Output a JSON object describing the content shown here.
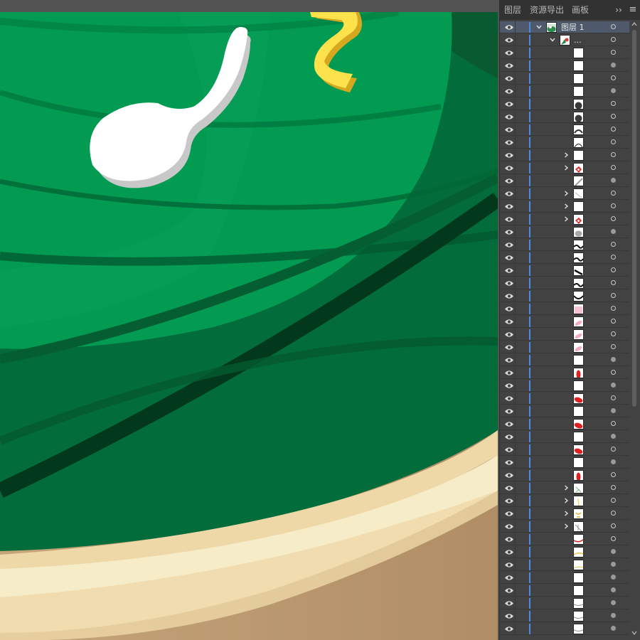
{
  "tabs": [
    {
      "label": "图层",
      "active": true
    },
    {
      "label": "资源导出",
      "active": false
    },
    {
      "label": "画板",
      "active": false
    }
  ],
  "panel_buttons": {
    "collapse": "››",
    "menu": "≡"
  },
  "layer_top": {
    "name": "图层 1",
    "thumbnail": "layer-thumb-icon"
  },
  "group_row": {
    "name": "...",
    "thumbnail": "group-thumb-icon"
  },
  "sublayers": [
    {
      "thumb": "blank",
      "expandable": false,
      "target": "ring"
    },
    {
      "thumb": "blank",
      "expandable": false,
      "target": "fill"
    },
    {
      "thumb": "blank",
      "expandable": false,
      "target": "ring"
    },
    {
      "thumb": "blank",
      "expandable": false,
      "target": "fill"
    },
    {
      "thumb": "dark-circle",
      "expandable": false,
      "target": "ring"
    },
    {
      "thumb": "dark-circle",
      "expandable": false,
      "target": "ring"
    },
    {
      "thumb": "arc",
      "expandable": false,
      "target": "ring"
    },
    {
      "thumb": "arc-open",
      "expandable": false,
      "target": "ring"
    },
    {
      "thumb": "blank",
      "expandable": true,
      "target": "ring"
    },
    {
      "thumb": "red-shape",
      "expandable": true,
      "target": "ring"
    },
    {
      "thumb": "stroke-gray",
      "expandable": false,
      "target": "fill"
    },
    {
      "thumb": "stroke-light",
      "expandable": true,
      "target": "ring"
    },
    {
      "thumb": "blank",
      "expandable": true,
      "target": "ring"
    },
    {
      "thumb": "red-shape",
      "expandable": true,
      "target": "ring"
    },
    {
      "thumb": "gray-blob",
      "expandable": false,
      "target": "fill"
    },
    {
      "thumb": "black-wave",
      "expandable": false,
      "target": "ring"
    },
    {
      "thumb": "black-wave",
      "expandable": false,
      "target": "ring"
    },
    {
      "thumb": "black-diag",
      "expandable": false,
      "target": "ring"
    },
    {
      "thumb": "black-wave",
      "expandable": false,
      "target": "ring"
    },
    {
      "thumb": "black-curve",
      "expandable": false,
      "target": "ring"
    },
    {
      "thumb": "pink-fill",
      "expandable": false,
      "target": "ring"
    },
    {
      "thumb": "pink-oval",
      "expandable": false,
      "target": "ring"
    },
    {
      "thumb": "pink-oval",
      "expandable": false,
      "target": "ring"
    },
    {
      "thumb": "pink-oval",
      "expandable": false,
      "target": "ring"
    },
    {
      "thumb": "blank",
      "expandable": false,
      "target": "fill"
    },
    {
      "thumb": "red-oval-v",
      "expandable": false,
      "target": "ring"
    },
    {
      "thumb": "blank",
      "expandable": false,
      "target": "fill"
    },
    {
      "thumb": "red-oval",
      "expandable": false,
      "target": "ring"
    },
    {
      "thumb": "blank",
      "expandable": false,
      "target": "fill"
    },
    {
      "thumb": "red-oval",
      "expandable": false,
      "target": "ring"
    },
    {
      "thumb": "blank",
      "expandable": false,
      "target": "fill"
    },
    {
      "thumb": "red-oval",
      "expandable": false,
      "target": "ring"
    },
    {
      "thumb": "blank",
      "expandable": false,
      "target": "fill"
    },
    {
      "thumb": "red-oval-v",
      "expandable": false,
      "target": "ring"
    },
    {
      "thumb": "sketch-green",
      "expandable": true,
      "target": "ring"
    },
    {
      "thumb": "sketch-yellow",
      "expandable": true,
      "target": "ring"
    },
    {
      "thumb": "sketch-gold",
      "expandable": true,
      "target": "ring"
    },
    {
      "thumb": "sketch-gray",
      "expandable": true,
      "target": "ring"
    },
    {
      "thumb": "red-line",
      "expandable": false,
      "target": "ring"
    },
    {
      "thumb": "yellow-line",
      "expandable": false,
      "target": "fill"
    },
    {
      "thumb": "yellow-line2",
      "expandable": false,
      "target": "fill"
    },
    {
      "thumb": "blank",
      "expandable": false,
      "target": "fill"
    },
    {
      "thumb": "blank",
      "expandable": false,
      "target": "fill"
    },
    {
      "thumb": "gray-line",
      "expandable": false,
      "target": "fill"
    },
    {
      "thumb": "gray-line",
      "expandable": false,
      "target": "fill"
    },
    {
      "thumb": "gray-line",
      "expandable": false,
      "target": "fill"
    }
  ],
  "colors": {
    "panel_bg": "#424242",
    "selected_row": "#4e5a6c",
    "layer_color": "#4f89e6",
    "green_dark": "#006b3c",
    "green_mid": "#008a4a",
    "green_light": "#009d55",
    "ribbon_yellow": "#fce04a",
    "beige_light": "#f7ecc8",
    "beige_mid": "#eed8a8",
    "tan": "#b8956c"
  }
}
